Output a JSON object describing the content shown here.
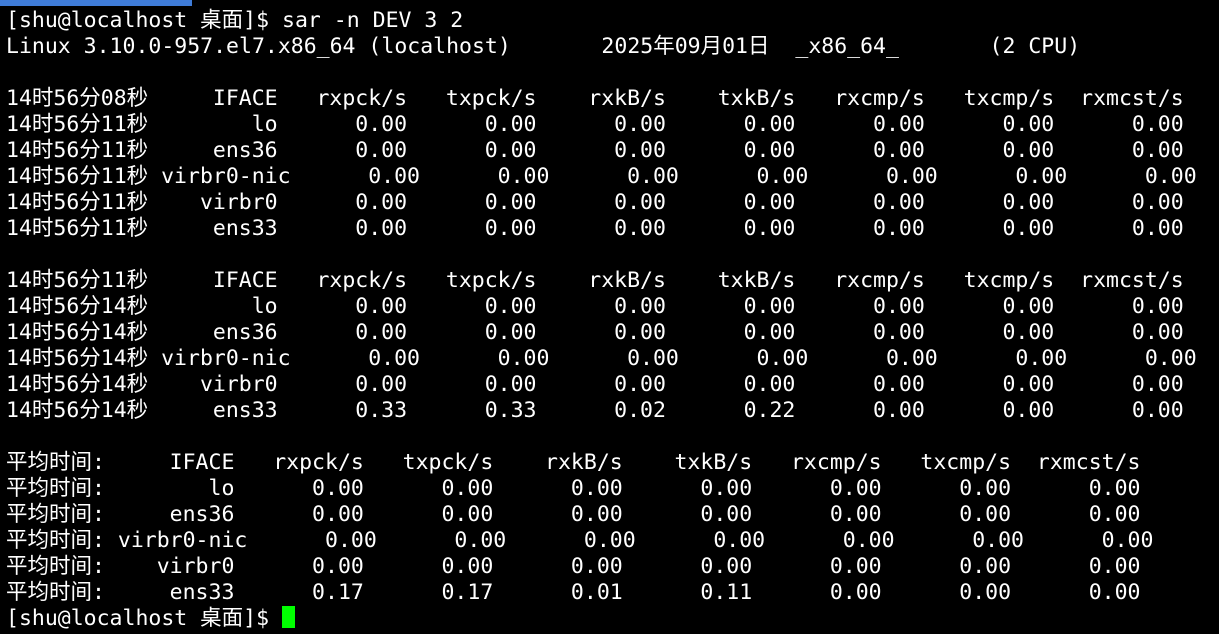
{
  "prompt_host": "[shu@localhost",
  "prompt_dir": "桌面]$",
  "command": "sar -n DEV 3 2",
  "sysinfo": "Linux 3.10.0-957.el7.x86_64 (localhost)       2025年09月01日  _x86_64_       (2 CPU)",
  "block1": [
    "14时56分08秒     IFACE   rxpck/s   txpck/s    rxkB/s    txkB/s   rxcmp/s   txcmp/s  rxmcst/s",
    "14时56分11秒        lo      0.00      0.00      0.00      0.00      0.00      0.00      0.00",
    "14时56分11秒     ens36      0.00      0.00      0.00      0.00      0.00      0.00      0.00",
    "14时56分11秒 virbr0-nic      0.00      0.00      0.00      0.00      0.00      0.00      0.00",
    "14时56分11秒    virbr0      0.00      0.00      0.00      0.00      0.00      0.00      0.00",
    "14时56分11秒     ens33      0.00      0.00      0.00      0.00      0.00      0.00      0.00"
  ],
  "block2": [
    "14时56分11秒     IFACE   rxpck/s   txpck/s    rxkB/s    txkB/s   rxcmp/s   txcmp/s  rxmcst/s",
    "14时56分14秒        lo      0.00      0.00      0.00      0.00      0.00      0.00      0.00",
    "14时56分14秒     ens36      0.00      0.00      0.00      0.00      0.00      0.00      0.00",
    "14时56分14秒 virbr0-nic      0.00      0.00      0.00      0.00      0.00      0.00      0.00",
    "14时56分14秒    virbr0      0.00      0.00      0.00      0.00      0.00      0.00      0.00",
    "14时56分14秒     ens33      0.33      0.33      0.02      0.22      0.00      0.00      0.00"
  ],
  "average": [
    "平均时间:     IFACE   rxpck/s   txpck/s    rxkB/s    txkB/s   rxcmp/s   txcmp/s  rxmcst/s",
    "平均时间:        lo      0.00      0.00      0.00      0.00      0.00      0.00      0.00",
    "平均时间:     ens36      0.00      0.00      0.00      0.00      0.00      0.00      0.00",
    "平均时间: virbr0-nic      0.00      0.00      0.00      0.00      0.00      0.00      0.00",
    "平均时间:    virbr0      0.00      0.00      0.00      0.00      0.00      0.00      0.00",
    "平均时间:     ens33      0.17      0.17      0.01      0.11      0.00      0.00      0.00"
  ],
  "colors": {
    "background": "#000000",
    "text": "#ffffff",
    "cursor": "#00ff00",
    "tab_accent": "#3f7cd8"
  }
}
